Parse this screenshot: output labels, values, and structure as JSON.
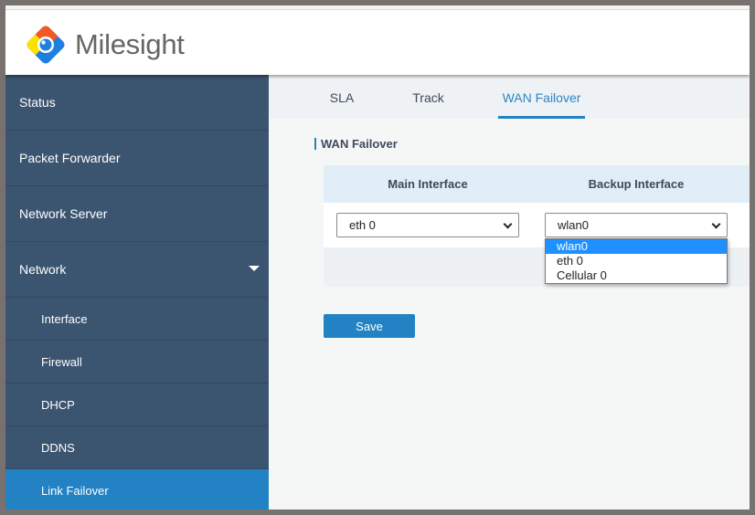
{
  "brand": {
    "name": "Milesight",
    "colors": {
      "sidebar": "#3b5470",
      "accent": "#2282c3",
      "highlight": "#1e90ff"
    }
  },
  "sidebar": {
    "items": [
      {
        "label": "Status"
      },
      {
        "label": "Packet Forwarder"
      },
      {
        "label": "Network Server"
      },
      {
        "label": "Network",
        "expanded": true
      }
    ],
    "subitems": [
      {
        "label": "Interface"
      },
      {
        "label": "Firewall"
      },
      {
        "label": "DHCP"
      },
      {
        "label": "DDNS"
      },
      {
        "label": "Link Failover",
        "active": true
      }
    ]
  },
  "tabs": [
    {
      "label": "SLA"
    },
    {
      "label": "Track"
    },
    {
      "label": "WAN Failover",
      "active": true
    }
  ],
  "section": {
    "title": "WAN Failover"
  },
  "table": {
    "headers": [
      "Main Interface",
      "Backup Interface"
    ],
    "main_value": "eth 0",
    "backup_value": "wlan0"
  },
  "dropdown": {
    "options": [
      "wlan0",
      "eth 0",
      "Cellular 0"
    ],
    "highlighted": "wlan0"
  },
  "save_label": "Save"
}
